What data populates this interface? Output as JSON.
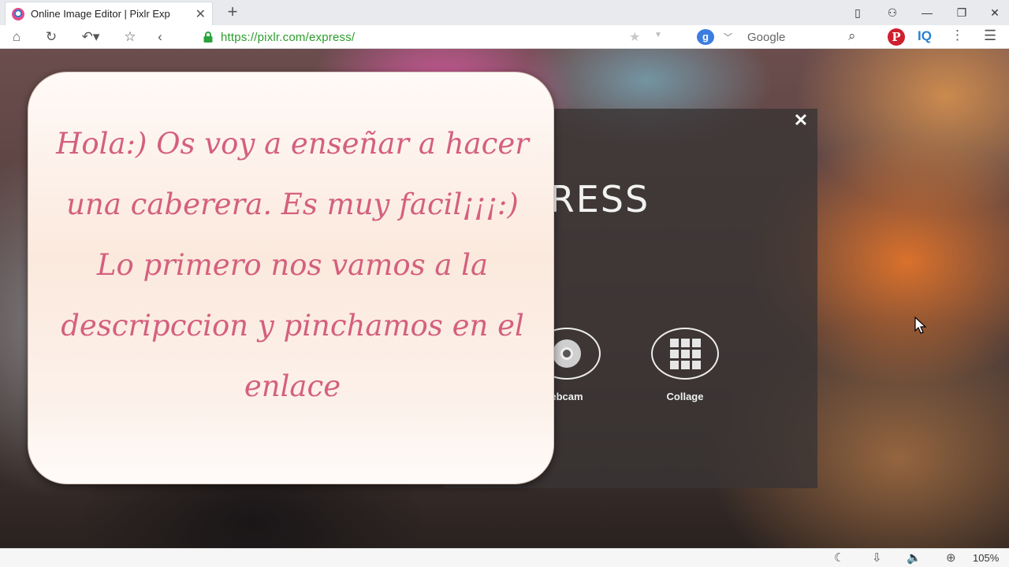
{
  "browser": {
    "tab_title": "Online Image Editor | Pixlr Exp",
    "url": "https://pixlr.com/express/",
    "search_placeholder": "Google",
    "search_engine_letter": "g",
    "zoom": "105%"
  },
  "dialog": {
    "title": "PRESS",
    "close_symbol": "✕",
    "options": [
      {
        "label": "ebcam",
        "icon": "webcam-icon"
      },
      {
        "label": "Collage",
        "icon": "collage-grid-icon"
      }
    ]
  },
  "note": {
    "lines": [
      "Hola:) Os voy a enseñar a hacer",
      "una caberera. Es muy facil¡¡¡:)",
      "Lo primero nos vamos a la",
      "descripccion y  pinchamos en el",
      "enlace"
    ]
  },
  "colors": {
    "accent_green": "#2a9d2a",
    "note_text": "#d4607e",
    "pinterest_red": "#cf1f2f"
  }
}
